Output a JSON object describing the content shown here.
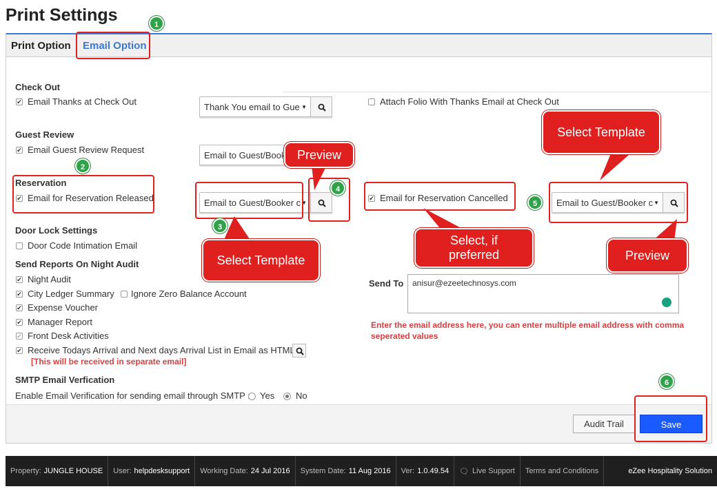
{
  "page": {
    "title": "Print Settings"
  },
  "tabs": [
    {
      "label": "Print Option"
    },
    {
      "label": "Email Option"
    }
  ],
  "checkout": {
    "heading": "Check Out",
    "email_thanks": "Email Thanks at Check Out",
    "thanks_template": "Thank You email to Gue",
    "attach_folio": "Attach Folio With Thanks Email at Check Out"
  },
  "guest_review": {
    "heading": "Guest Review",
    "email_request": "Email Guest Review Request",
    "template": "Email to Guest/Booker"
  },
  "reservation": {
    "heading": "Reservation",
    "released": "Email for Reservation Released",
    "released_template": "Email to Guest/Booker c",
    "cancelled": "Email for Reservation Cancelled",
    "cancelled_template": "Email to Guest/Booker c"
  },
  "door_lock": {
    "heading": "Door Lock Settings",
    "intimation": "Door Code Intimation Email"
  },
  "night_audit": {
    "heading": "Send Reports On Night Audit",
    "items": {
      "night_audit": "Night Audit",
      "city_ledger": "City Ledger Summary",
      "ignore_zero": "Ignore Zero Balance Account",
      "expense": "Expense Voucher",
      "manager": "Manager Report",
      "front_desk": "Front Desk Activities",
      "arrival_list": "Receive Todays Arrival and Next days Arrival List in Email as HTML"
    },
    "separate_note": "[This will be received in separate email]"
  },
  "send_to": {
    "label": "Send To",
    "value": "anisur@ezeetechnosys.com",
    "help_line1": "Enter the email address here, you can enter multiple email address with comma",
    "help_line2": "seperated values"
  },
  "smtp": {
    "heading": "SMTP Email Verfication",
    "question": "Enable Email Verification for sending email through SMTP :",
    "yes": "Yes",
    "no": "No"
  },
  "buttons": {
    "audit_trail": "Audit Trail",
    "save": "Save"
  },
  "annotations": {
    "badges": [
      "1",
      "2",
      "3",
      "4",
      "5",
      "6"
    ],
    "preview": "Preview",
    "select_template": "Select Template",
    "select_if_line1": "Select, if",
    "select_if_line2": "preferred"
  },
  "status_bar": {
    "property_label": "Property:",
    "property": "JUNGLE HOUSE",
    "user_label": "User:",
    "user": "helpdesksupport",
    "working_label": "Working Date:",
    "working": "24 Jul 2016",
    "system_label": "System Date:",
    "system": "11 Aug 2016",
    "ver_label": "Ver:",
    "ver": "1.0.49.54",
    "live_support": "Live Support",
    "terms": "Terms and Conditions",
    "brand": "eZee Hospitality Solution"
  },
  "colors": {
    "accent": "#3c78d8",
    "annotation_red": "#e0201f",
    "badge_green": "#2fa24a",
    "save_blue": "#1a5bff"
  }
}
